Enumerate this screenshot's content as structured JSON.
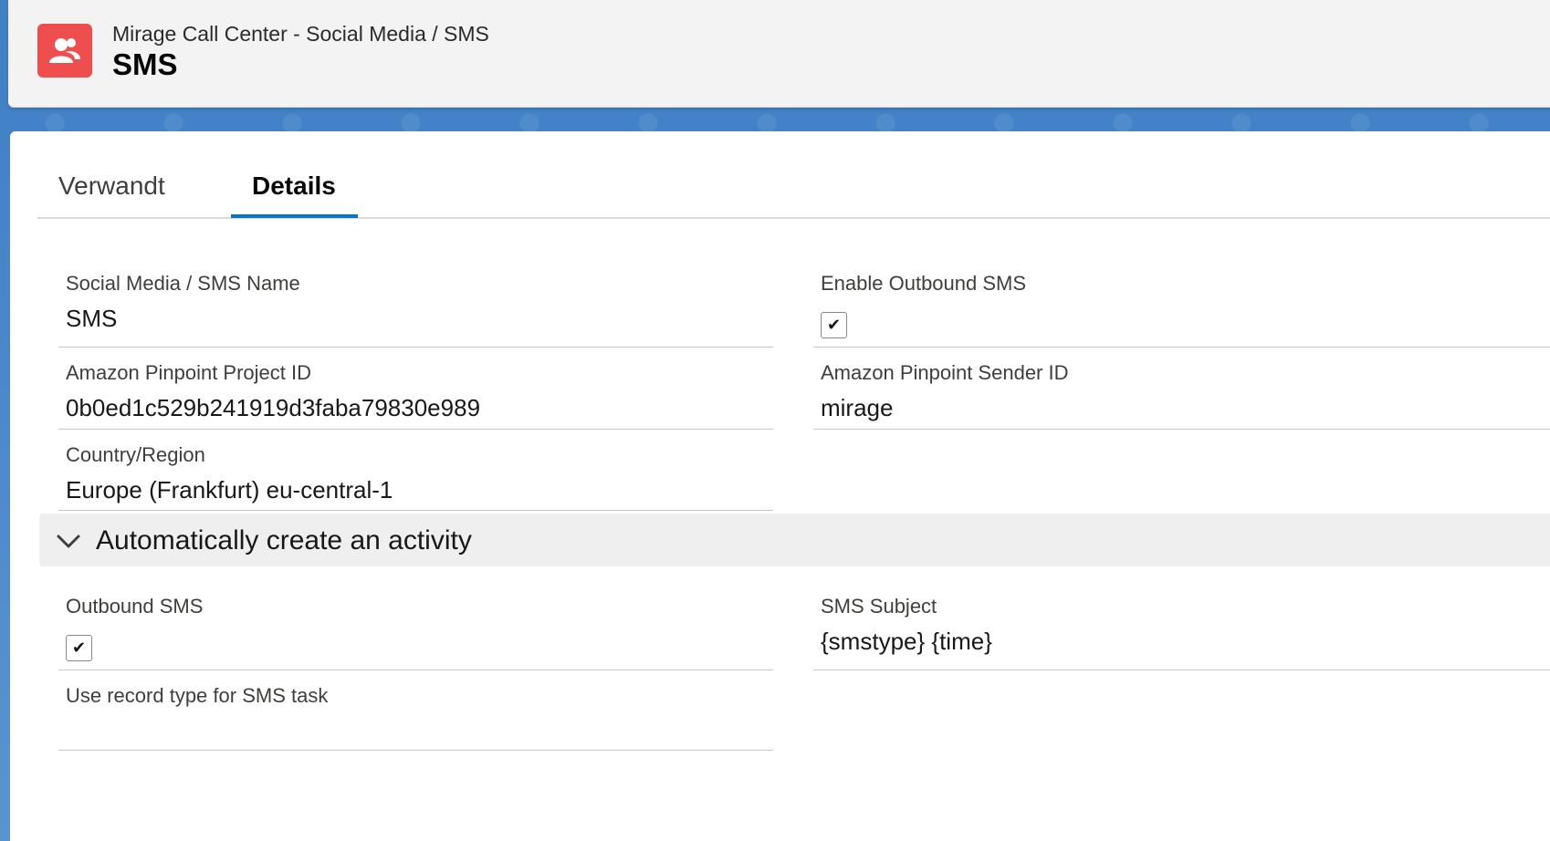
{
  "header": {
    "icon": "record-people-icon",
    "subtitle": "Mirage Call Center - Social Media / SMS",
    "title": "SMS",
    "accent_color": "#ef4e4e"
  },
  "tabs": [
    {
      "label": "Verwandt",
      "active": false
    },
    {
      "label": "Details",
      "active": true
    }
  ],
  "fields": {
    "name": {
      "label": "Social Media / SMS Name",
      "value": "SMS"
    },
    "enable_outbound": {
      "label": "Enable Outbound SMS",
      "checked": true
    },
    "project_id": {
      "label": "Amazon Pinpoint Project ID",
      "value": "0b0ed1c529b241919d3faba79830e989"
    },
    "sender_id": {
      "label": "Amazon Pinpoint Sender ID",
      "value": "mirage"
    },
    "region": {
      "label": "Country/Region",
      "value": "Europe (Frankfurt) eu-central-1"
    }
  },
  "section": {
    "title": "Automatically create an activity",
    "expanded": true,
    "fields": {
      "outbound_sms": {
        "label": "Outbound SMS",
        "checked": true
      },
      "sms_subject": {
        "label": "SMS Subject",
        "value": "{smstype} {time}"
      },
      "record_type": {
        "label": "Use record type for SMS task",
        "value": ""
      }
    }
  },
  "colors": {
    "tab_active": "#0176d3",
    "background": "#3f7fc6"
  }
}
